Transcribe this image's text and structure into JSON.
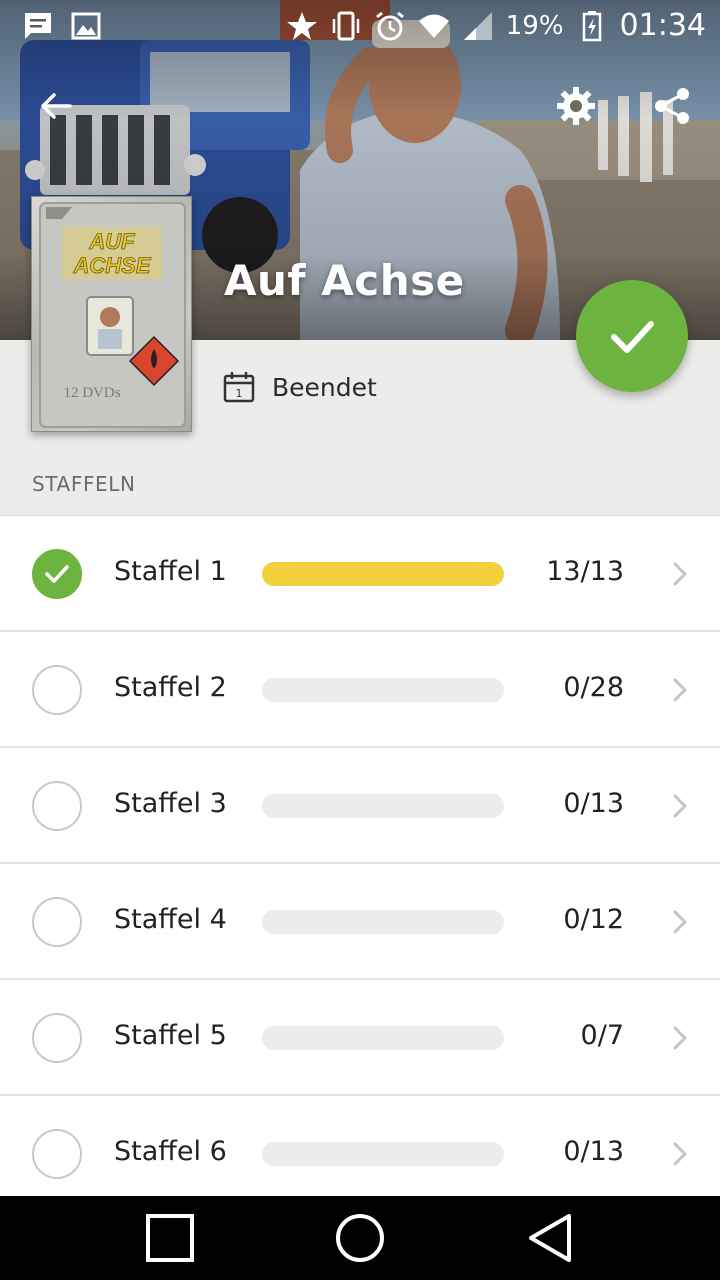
{
  "status_bar": {
    "battery_pct": "19%",
    "time": "01:34",
    "left_icons": [
      "message-icon",
      "image-icon"
    ],
    "right_icons": [
      "star-icon",
      "vibrate-icon",
      "alarm-icon",
      "wifi-icon",
      "signal-icon",
      "battery-icon"
    ]
  },
  "toolbar": {
    "back_icon": "arrow-left-icon",
    "settings_icon": "gear-icon",
    "share_icon": "share-icon"
  },
  "show": {
    "title": "Auf Achse",
    "status": "Beendet",
    "status_icon": "calendar-icon",
    "poster": {
      "logo_line1": "AUF",
      "logo_line2": "ACHSE",
      "dvd_count": "12 DVDs"
    }
  },
  "fab": {
    "icon": "check-icon"
  },
  "section_label": "STAFFELN",
  "seasons": [
    {
      "name": "Staffel 1",
      "count": "13/13",
      "progress": 1.0,
      "completed": true
    },
    {
      "name": "Staffel 2",
      "count": "0/28",
      "progress": 0.0,
      "completed": false
    },
    {
      "name": "Staffel 3",
      "count": "0/13",
      "progress": 0.0,
      "completed": false
    },
    {
      "name": "Staffel 4",
      "count": "0/12",
      "progress": 0.0,
      "completed": false
    },
    {
      "name": "Staffel 5",
      "count": "0/7",
      "progress": 0.0,
      "completed": false
    },
    {
      "name": "Staffel 6",
      "count": "0/13",
      "progress": 0.0,
      "completed": false
    }
  ],
  "nav": {
    "recents_icon": "square-icon",
    "home_icon": "circle-icon",
    "back_icon": "triangle-back-icon"
  },
  "colors": {
    "accent_green": "#6cb33f",
    "progress_yellow": "#f2cf3c",
    "track_gray": "#ececea"
  }
}
